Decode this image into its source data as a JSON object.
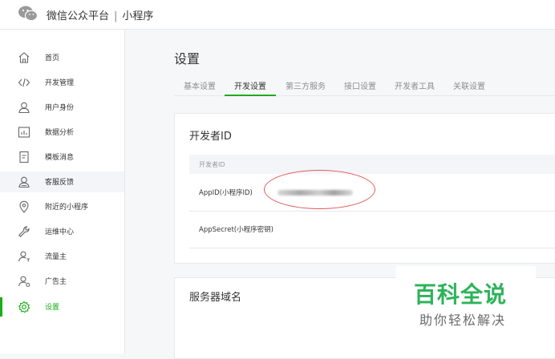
{
  "header": {
    "brand": "微信公众平台",
    "separator": "|",
    "product": "小程序"
  },
  "sidebar": {
    "items": [
      {
        "label": "首页",
        "icon": "home-icon"
      },
      {
        "label": "开发管理",
        "icon": "code-icon"
      },
      {
        "label": "用户身份",
        "icon": "user-icon"
      },
      {
        "label": "数据分析",
        "icon": "chart-icon"
      },
      {
        "label": "模板消息",
        "icon": "document-icon"
      },
      {
        "label": "客服反馈",
        "icon": "customer-service-icon",
        "selected": true
      },
      {
        "label": "附近的小程序",
        "icon": "location-icon"
      },
      {
        "label": "运维中心",
        "icon": "wrench-icon"
      },
      {
        "label": "流量主",
        "icon": "traffic-user-icon"
      },
      {
        "label": "广告主",
        "icon": "advertiser-icon"
      },
      {
        "label": "设置",
        "icon": "gear-icon",
        "current": true
      }
    ]
  },
  "main": {
    "title": "设置",
    "tabs": [
      "基本设置",
      "开发设置",
      "第三方服务",
      "接口设置",
      "开发者工具",
      "关联设置"
    ],
    "active_tab": "开发设置",
    "developer_card": {
      "title": "开发者ID",
      "table_header": "开发者ID",
      "rows": [
        {
          "label": "AppID(小程序ID)",
          "value_blurred": true
        },
        {
          "label": "AppSecret(小程序密钥)"
        }
      ]
    },
    "server_card": {
      "title": "服务器域名"
    }
  },
  "watermark": {
    "main": "百科全说",
    "sub": "助你轻松解决"
  },
  "colors": {
    "accent": "#1aad19",
    "annotation": "#e05a5a",
    "watermark_green": "#2eb35a"
  }
}
